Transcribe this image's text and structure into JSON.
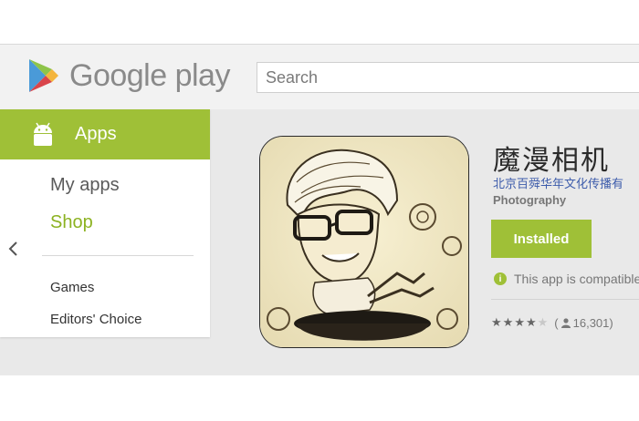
{
  "header": {
    "logo_text": "Google play",
    "search_placeholder": "Search"
  },
  "sidebar": {
    "category_label": "Apps",
    "items": [
      {
        "label": "My apps"
      },
      {
        "label": "Shop"
      },
      {
        "label": "Games"
      },
      {
        "label": "Editors' Choice"
      }
    ]
  },
  "app": {
    "title": "魔漫相机",
    "developer": "北京百舜华年文化传播有",
    "category": "Photography",
    "install_label": "Installed",
    "compat_text": "This app is compatible",
    "rating_stars": 4,
    "rating_count_open": "(",
    "rating_count": "16,301",
    "rating_count_close": ")"
  },
  "colors": {
    "accent": "#9fc037",
    "link": "#3d5cab"
  }
}
